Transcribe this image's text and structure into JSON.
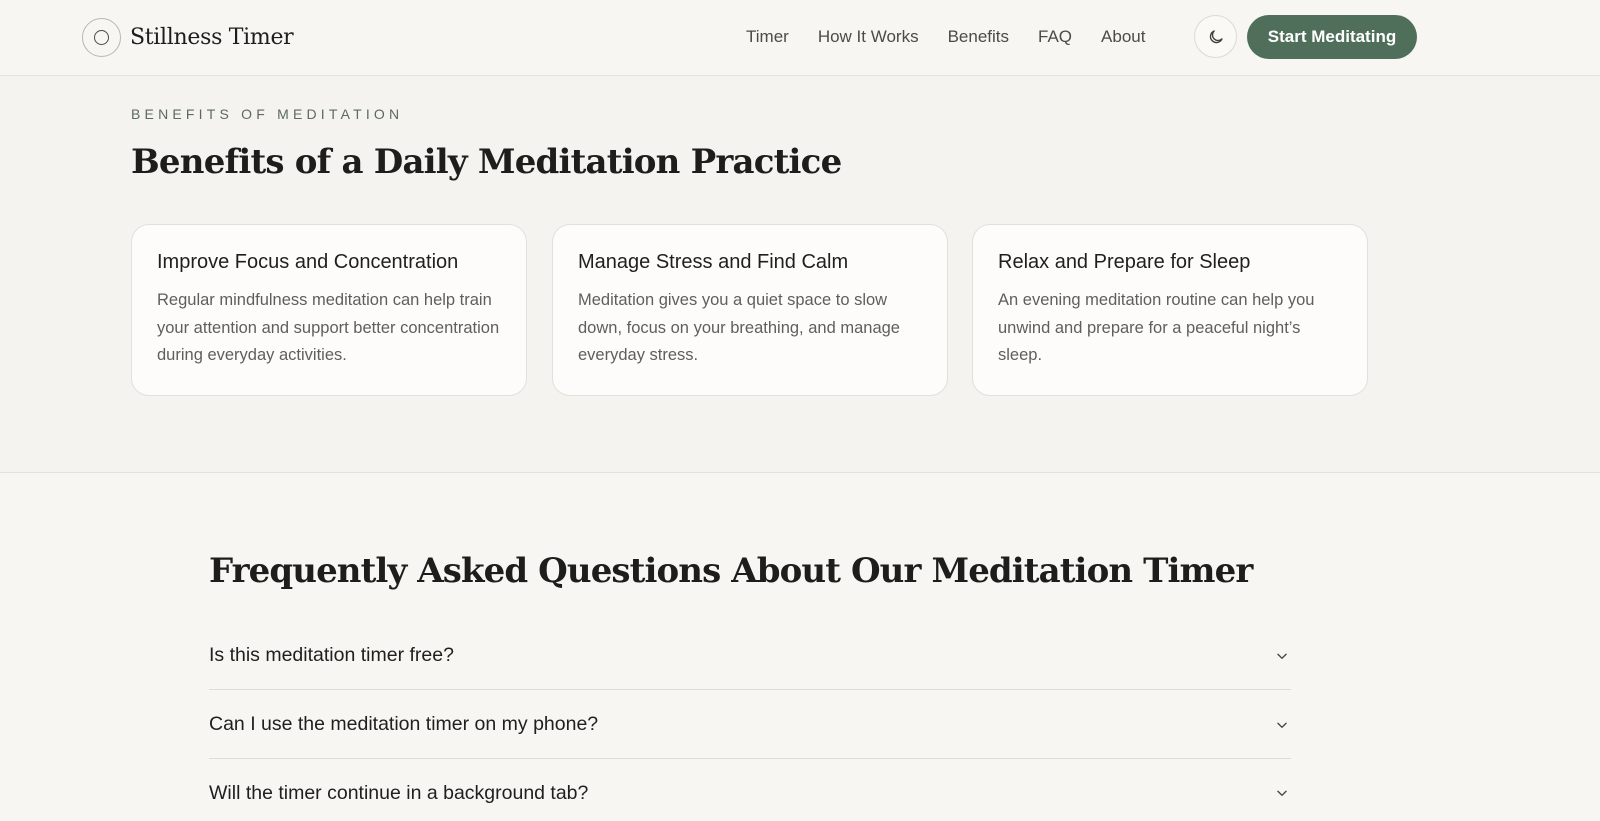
{
  "header": {
    "brand_name": "Stillness Timer",
    "nav": [
      "Timer",
      "How It Works",
      "Benefits",
      "FAQ",
      "About"
    ],
    "theme_toggle_icon": "moon-icon",
    "cta_label": "Start Meditating",
    "accent_color": "#4f6f5a"
  },
  "benefits": {
    "eyebrow": "BENEFITS OF MEDITATION",
    "title": "Benefits of a Daily Meditation Practice",
    "cards": [
      {
        "title": "Improve Focus and Concentration",
        "text": "Regular mindfulness meditation can help train your attention and support better concentration during everyday activities."
      },
      {
        "title": "Manage Stress and Find Calm",
        "text": "Meditation gives you a quiet space to slow down, focus on your breathing, and manage everyday stress."
      },
      {
        "title": "Relax and Prepare for Sleep",
        "text": "An evening meditation routine can help you unwind and prepare for a peaceful night’s sleep."
      }
    ]
  },
  "faq": {
    "title": "Frequently Asked Questions About Our Meditation Timer",
    "items": [
      {
        "question": "Is this meditation timer free?",
        "icon": "chevron-down-icon"
      },
      {
        "question": "Can I use the meditation timer on my phone?",
        "icon": "chevron-down-icon"
      },
      {
        "question": "Will the timer continue in a background tab?",
        "icon": "chevron-down-icon"
      }
    ]
  }
}
